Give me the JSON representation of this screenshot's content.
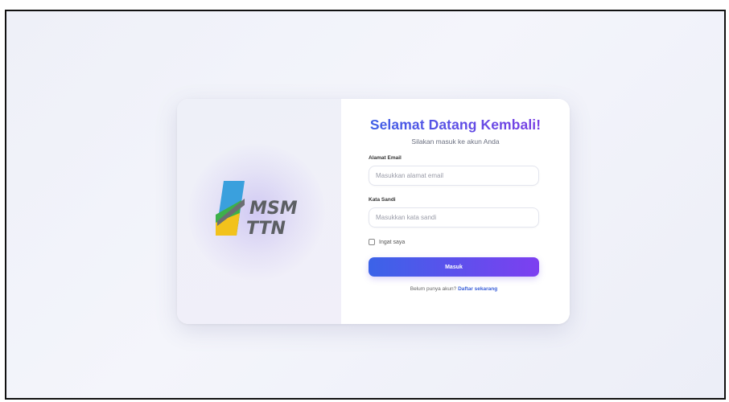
{
  "brand": {
    "logo_line1": "MSM",
    "logo_line2": "TTN",
    "colors": {
      "blue": "#3aa0dd",
      "green": "#3db04a",
      "yellow": "#f2c21c",
      "gray": "#6b6e72"
    }
  },
  "login": {
    "title": "Selamat Datang Kembali!",
    "subtitle": "Silakan masuk ke akun Anda",
    "email_label": "Alamat Email",
    "email_placeholder": "Masukkan alamat email",
    "password_label": "Kata Sandi",
    "password_placeholder": "Masukkan kata sandi",
    "remember_label": "Ingat saya",
    "submit_label": "Masuk",
    "signup_prompt": "Belum punya akun?",
    "signup_link": "Daftar sekarang"
  },
  "theme": {
    "accent_start": "#3b63e8",
    "accent_end": "#7d3ff0"
  }
}
